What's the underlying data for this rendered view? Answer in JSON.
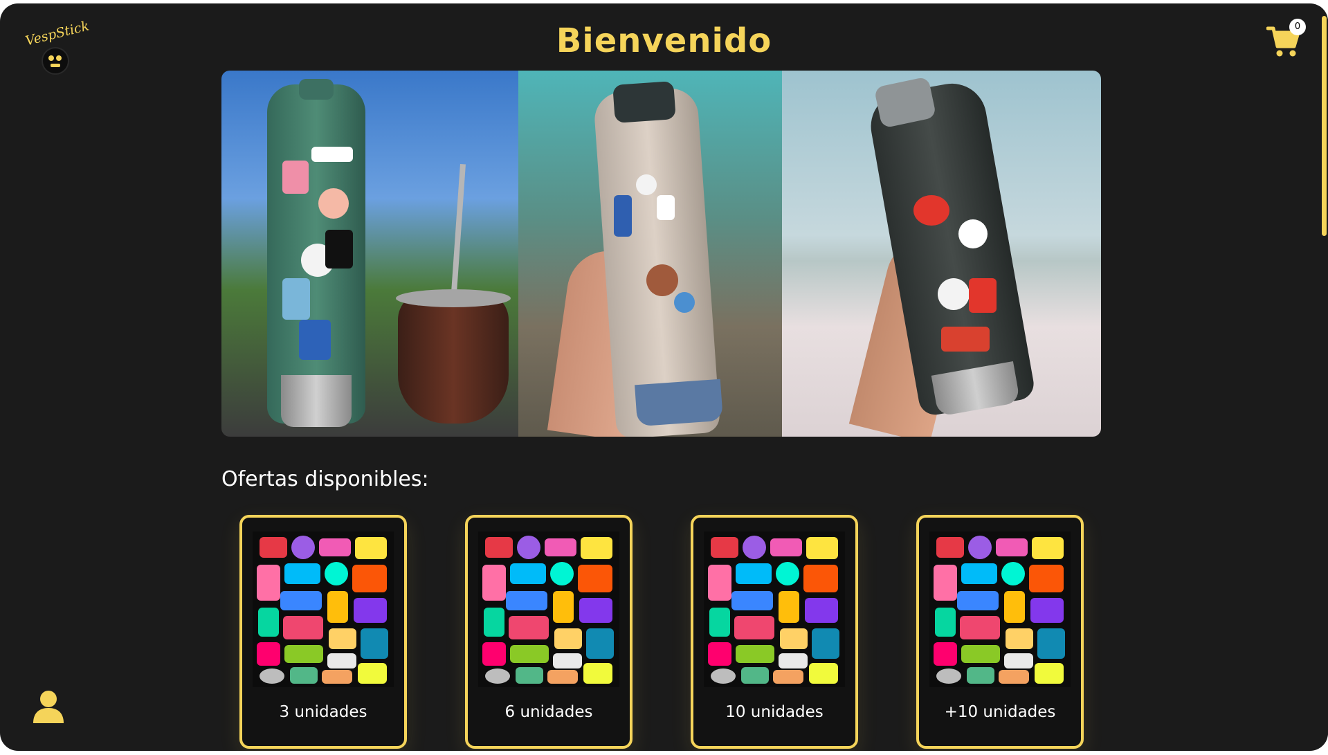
{
  "brand": {
    "logo_text": "VespStick"
  },
  "header": {
    "title": "Bienvenido"
  },
  "cart": {
    "count": "0",
    "icon": "cart-icon"
  },
  "user": {
    "icon": "user-icon"
  },
  "offers": {
    "title": "Ofertas disponibles:",
    "cards": [
      {
        "label": "3 unidades"
      },
      {
        "label": "6 unidades"
      },
      {
        "label": "10 unidades"
      },
      {
        "label": "+10 unidades"
      }
    ]
  },
  "colors": {
    "accent": "#f5d45a",
    "background": "#1b1b1b",
    "text": "#ffffff"
  }
}
